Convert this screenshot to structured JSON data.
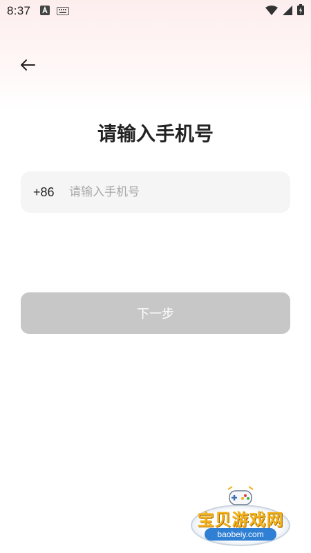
{
  "status_bar": {
    "time": "8:37",
    "left_icons": [
      "font-a-icon",
      "keyboard-icon"
    ],
    "right_icons": [
      "wifi-icon",
      "signal-icon",
      "battery-charging-icon"
    ]
  },
  "nav": {
    "back_icon": "arrow-left-icon"
  },
  "title": "请输入手机号",
  "phone": {
    "country_code": "+86",
    "placeholder": "请输入手机号",
    "value": ""
  },
  "next_button": {
    "label": "下一步",
    "state": "disabled"
  },
  "watermark": {
    "title": "宝贝游戏网",
    "url": "baobeiy.com",
    "icon": "gamepad-icon"
  },
  "colors": {
    "top_gradient": "#fdeeee",
    "input_bg": "#f5f5f5",
    "button_disabled": "#c7c7c7",
    "placeholder": "#a8a8a8",
    "title_text": "#222222"
  }
}
